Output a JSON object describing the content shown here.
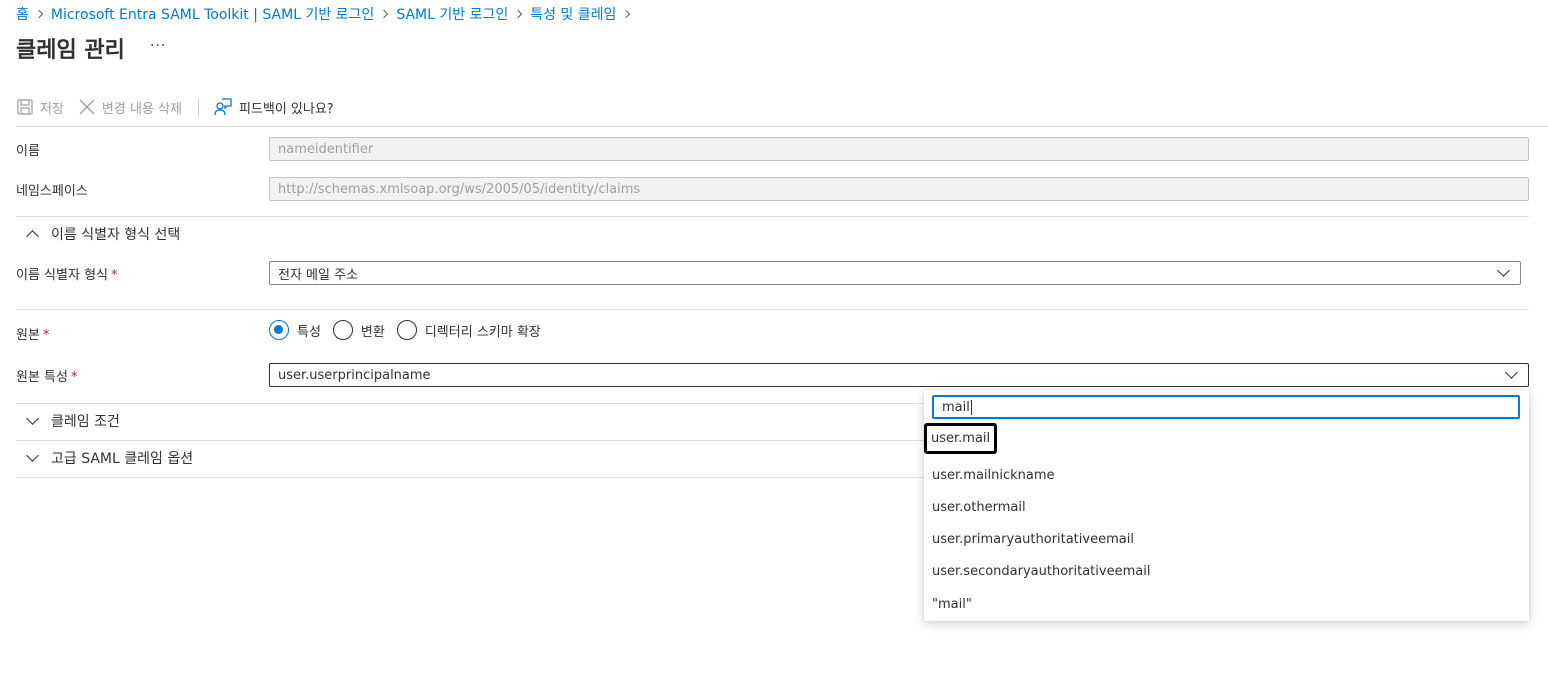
{
  "breadcrumb": {
    "items": [
      "홈",
      "Microsoft Entra SAML Toolkit | SAML 기반 로그인",
      "SAML 기반 로그인",
      "특성 및 클레임"
    ]
  },
  "page": {
    "title": "클레임 관리",
    "more": "···"
  },
  "toolbar": {
    "save_label": "저장",
    "discard_label": "변경 내용 삭제",
    "feedback_label": "피드백이 있나요?"
  },
  "form": {
    "name_label": "이름",
    "name_value": "nameidentifier",
    "namespace_label": "네임스페이스",
    "namespace_value": "http://schemas.xmlsoap.org/ws/2005/05/identity/claims",
    "nameid_section_label": "이름 식별자 형식 선택",
    "nameid_format_label": "이름 식별자 형식",
    "nameid_format_value": "전자 메일 주소",
    "source_label": "원본",
    "source_options": [
      "특성",
      "변환",
      "디렉터리 스키마 확장"
    ],
    "source_selected": "특성",
    "source_attr_label": "원본 특성",
    "source_attr_value": "user.userprincipalname",
    "required_mark": "*"
  },
  "sections": {
    "claim_conditions": "클레임 조건",
    "advanced_saml": "고급 SAML 클레임 옵션"
  },
  "popup": {
    "search_value": "mail",
    "options": [
      "user.mail",
      "user.mailnickname",
      "user.othermail",
      "user.primaryauthoritativeemail",
      "user.secondaryauthoritativeemail",
      "\"mail\""
    ]
  },
  "colors": {
    "accent": "#0078d4",
    "required": "#a4262c"
  }
}
